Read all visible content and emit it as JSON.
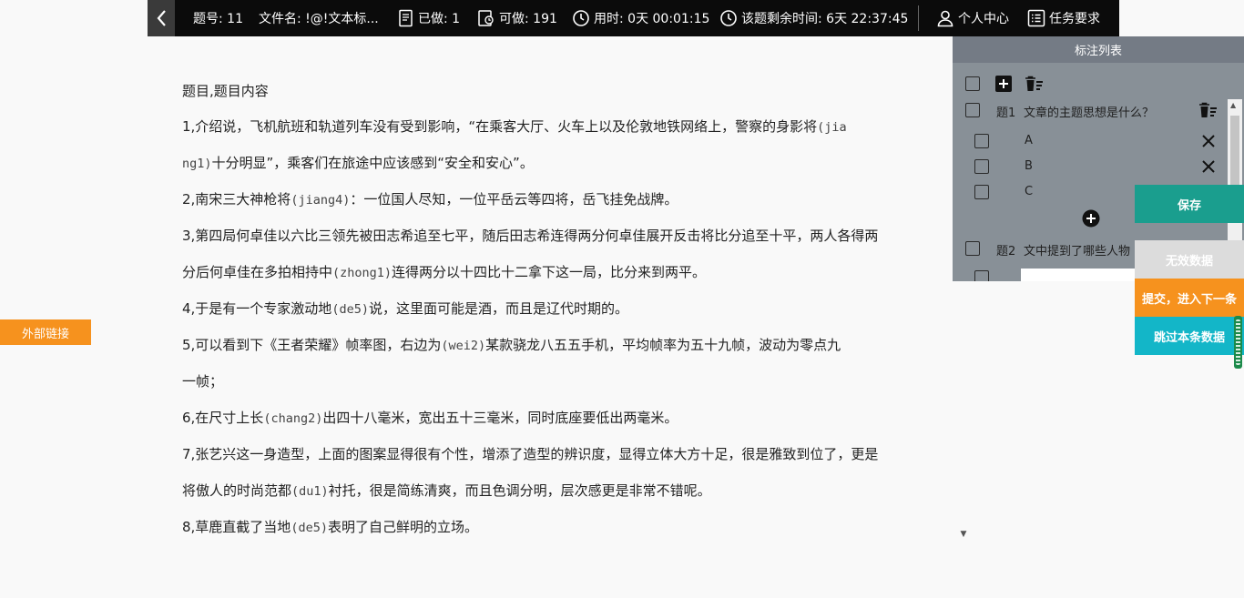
{
  "topbar": {
    "question_no": "题号: 11",
    "filename": "文件名: !@!文本标...",
    "done": "已做: 1",
    "available": "可做: 191",
    "time_used": "用时: 0天 00:01:15",
    "remaining": "该题剩余时间: 6天 22:37:45",
    "personal_center": "个人中心",
    "task_requirements": "任务要求"
  },
  "external_link": "外部链接",
  "article": {
    "title": "题目,题目内容",
    "lines": [
      [
        "1,介绍说，飞机航班和轨道列车没有受到影响，“在乘客大厅、火车上以及伦敦地铁网络上，警察的身影将",
        "(jia",
        "",
        ""
      ],
      [
        "",
        "ng1)",
        "十分明显”，乘客们在旅途中应该感到“安全和安心”。",
        ""
      ],
      [
        "2,南宋三大神枪将",
        "(jiang4)",
        "：一位国人尽知，一位平岳云等四将，岳飞挂免战牌。",
        ""
      ],
      [
        "3,第四局何卓佳以六比三领先被田志希追至七平，随后田志希连得两分何卓佳展开反击将比分追至十平，两人各得两",
        "",
        "",
        ""
      ],
      [
        "分后何卓佳在多拍相持中",
        "(zhong1)",
        "连得两分以十四比十二拿下这一局，比分来到两平。",
        ""
      ],
      [
        "4,于是有一个专家激动地",
        "(de5)",
        "说，这里面可能是酒，而且是辽代时期的。",
        ""
      ],
      [
        "5,可以看到下《王者荣耀》帧率图，右边为",
        "(wei2)",
        "某款骁龙八五五手机，平均帧率为五十九帧，波动为零点九",
        ""
      ],
      [
        "一帧；",
        "",
        "",
        ""
      ],
      [
        "6,在尺寸上长",
        "(chang2)",
        "出四十八毫米，宽出五十三毫米，同时底座要低出两毫米。",
        ""
      ],
      [
        "7,张艺兴这一身造型，上面的图案显得很有个性，增添了造型的辨识度，显得立体大方十足，很是雅致到位了，更是",
        "",
        "",
        ""
      ],
      [
        "将傲人的时尚范都",
        "(du1)",
        "衬托，很是简练清爽，而且色调分明，层次感更是非常不错呢。",
        ""
      ],
      [
        "8,草鹿直截了当地",
        "(de5)",
        "表明了自己鲜明的立场。",
        ""
      ]
    ]
  },
  "panel": {
    "title": "标注列表",
    "q1_label": "题1",
    "q1_text": "文章的主题思想是什么？",
    "options": [
      "A",
      "B",
      "C"
    ],
    "q2_label": "题2",
    "q2_text": "文中提到了哪些人物"
  },
  "actions": {
    "save": "保存",
    "invalid": "无效数据",
    "submit": "提交，进入下一条",
    "skip": "跳过本条数据"
  },
  "icons": [
    "back-arrow-icon",
    "file-icon",
    "edit-icon",
    "clock-icon",
    "person-icon",
    "list-icon",
    "add-icon",
    "trash-icon",
    "close-icon",
    "add-circle-icon"
  ]
}
